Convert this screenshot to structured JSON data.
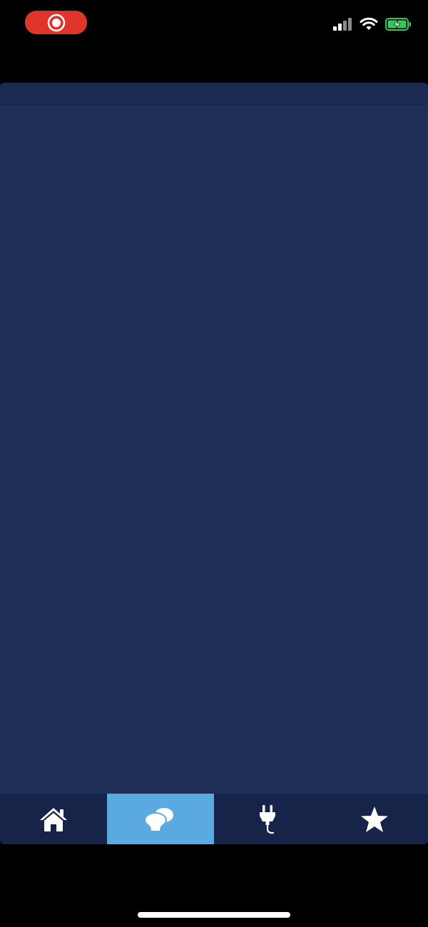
{
  "status_bar": {
    "recording_indicator_icon": "screen-recording-icon",
    "recording_color": "#e0352b",
    "signal_icon": "cellular-signal-icon",
    "wifi_icon": "wifi-icon",
    "battery_icon": "battery-charging-icon",
    "battery_color": "#34c759"
  },
  "app": {
    "background_color": "#1e2e54",
    "content_state": "loading-blank"
  },
  "tab_bar": {
    "background_color": "#16244a",
    "active_color": "#5aa9e0",
    "tabs": [
      {
        "icon": "home-icon",
        "active": false
      },
      {
        "icon": "cloud-weather-icon",
        "active": true
      },
      {
        "icon": "power-plug-icon",
        "active": false
      },
      {
        "icon": "star-icon",
        "active": false
      }
    ]
  }
}
